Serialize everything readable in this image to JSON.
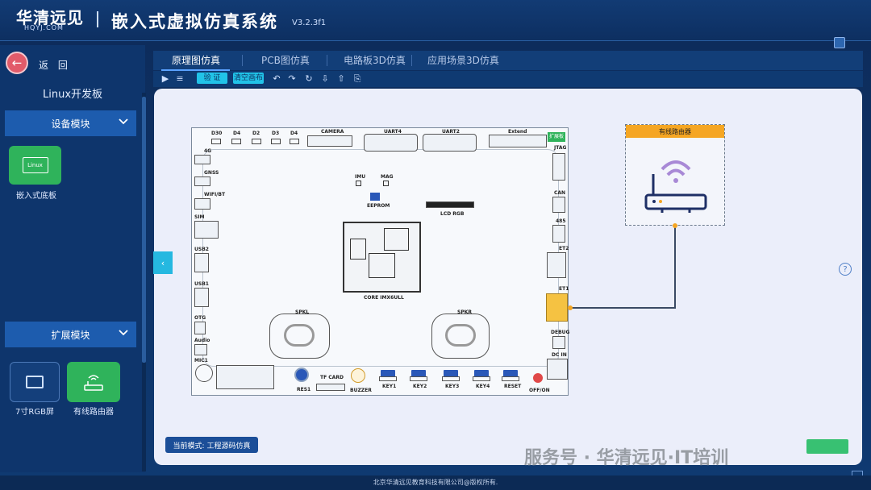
{
  "header": {
    "logo_main": "华清远见",
    "logo_sub": "HQYJ.COM",
    "title": "嵌入式虚拟仿真系统",
    "version": "V3.2.3f1"
  },
  "sidebar": {
    "back_label": "返 回",
    "board_title": "Linux开发板",
    "device_module": "设备模块",
    "device_items": [
      {
        "label": "嵌入式底板",
        "icon_text": "Linux"
      }
    ],
    "ext_module": "扩展模块",
    "ext_items": [
      {
        "label": "7寸RGB屏"
      },
      {
        "label": "有线路由器"
      }
    ]
  },
  "tabs": [
    {
      "label": "原理图仿真",
      "active": true
    },
    {
      "label": "PCB图仿真"
    },
    {
      "label": "电路板3D仿真"
    },
    {
      "label": "应用场景3D仿真"
    }
  ],
  "toolbar": {
    "verify": "验 证",
    "clear": "清空画布"
  },
  "board": {
    "leds": [
      "D30",
      "D4",
      "D2",
      "D3",
      "D4"
    ],
    "camera": "CAMERA",
    "uart4": "UART4",
    "uart2": "UART2",
    "extend": "Extend",
    "ext_tag": "扩展板",
    "left_ports": [
      "4G",
      "GNSS",
      "WIFI/BT",
      "SIM",
      "USB2",
      "USB1",
      "OTG",
      "Audio",
      "MIC1"
    ],
    "right_ports": [
      "JTAG",
      "CAN",
      "485",
      "ET2",
      "ET1",
      "DEBUG",
      "DC IN"
    ],
    "imu": "IMU",
    "mag": "MAG",
    "eeprom": "EEPROM",
    "lcd": "LCD RGB",
    "core": "CORE IMX6ULL",
    "spk_l": "SPKL",
    "spk_r": "SPKR",
    "bottom": [
      "RES1",
      "TF CARD",
      "BUZZER",
      "KEY1",
      "KEY2",
      "KEY3",
      "KEY4",
      "RESET",
      "OFF/ON"
    ]
  },
  "router": {
    "title": "有线路由器"
  },
  "mode": "当前模式: 工程源码仿真",
  "watermark": "服务号 · 华清远见·IT培训",
  "footer": "北京华清远见教育科技有限公司@版权所有."
}
